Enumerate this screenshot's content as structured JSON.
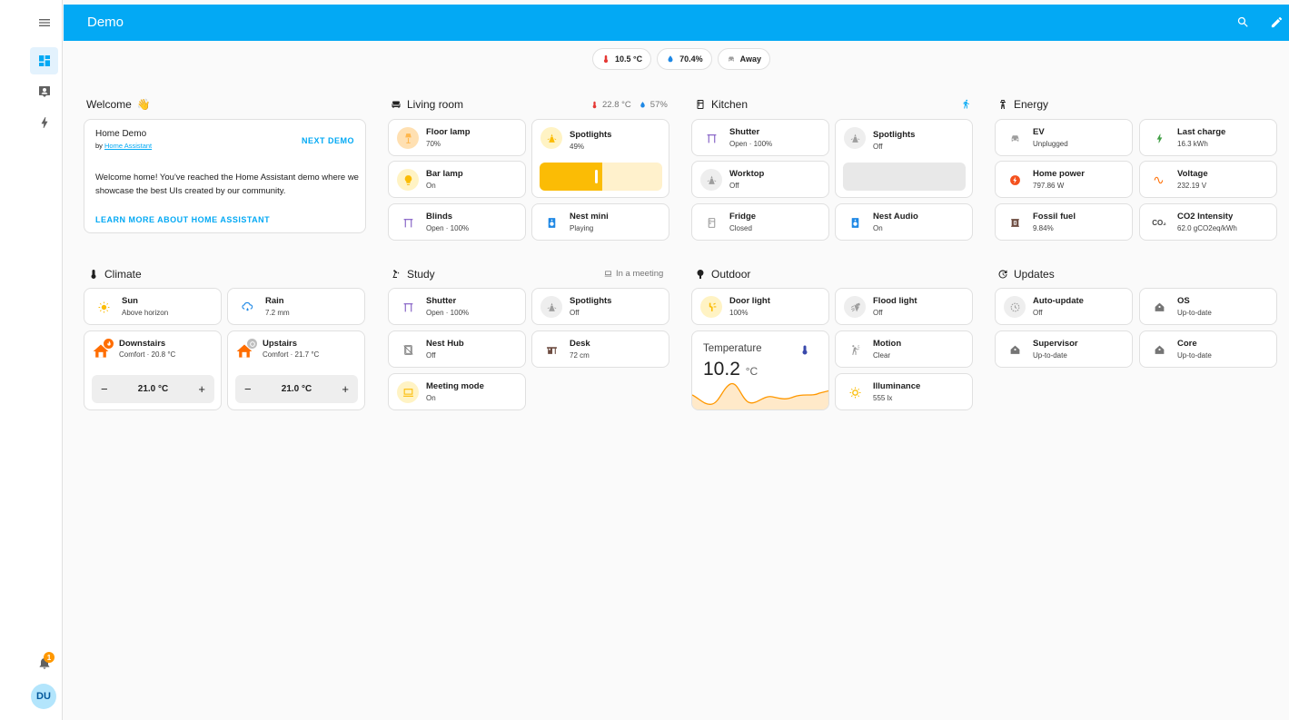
{
  "header": {
    "title": "Demo"
  },
  "colors": {
    "primary": "#03a9f4",
    "yellow": "#fbbc05",
    "orange": "#ff9800",
    "grey": "#9e9e9e",
    "purple": "#7e57c2",
    "blue": "#1e88e5",
    "brown": "#6d4c41",
    "green": "#43a047"
  },
  "sidebar": {
    "items": [
      "dashboard-icon",
      "map-icon",
      "energy-icon"
    ],
    "notification_count": "1",
    "avatar": "DU"
  },
  "badges": [
    {
      "value": "10.5 °C",
      "icon": "thermometer-icon"
    },
    {
      "value": "70.4%",
      "icon": "water-icon"
    },
    {
      "value": "Away",
      "icon": "car-icon"
    }
  ],
  "sections": {
    "welcome": {
      "title": "Welcome",
      "emoji": "👋"
    },
    "living_room": {
      "title": "Living room",
      "temp": "22.8 °C",
      "humidity": "57%"
    },
    "kitchen": {
      "title": "Kitchen"
    },
    "energy": {
      "title": "Energy"
    },
    "climate": {
      "title": "Climate"
    },
    "study": {
      "title": "Study",
      "status": "In a meeting"
    },
    "outdoor": {
      "title": "Outdoor"
    },
    "updates": {
      "title": "Updates"
    }
  },
  "welcome_card": {
    "title": "Home Demo",
    "by": "by",
    "by_link": "Home Assistant",
    "next": "NEXT DEMO",
    "body": "Welcome home! You've reached the Home Assistant demo where we showcase the best UIs created by our community.",
    "learn": "LEARN MORE ABOUT HOME ASSISTANT"
  },
  "living_room": {
    "floor_lamp": {
      "name": "Floor lamp",
      "state": "70%"
    },
    "bar_lamp": {
      "name": "Bar lamp",
      "state": "On"
    },
    "blinds": {
      "name": "Blinds",
      "state": "Open · 100%"
    },
    "spotlights": {
      "name": "Spotlights",
      "state": "49%",
      "level": 0.49
    },
    "nest_mini": {
      "name": "Nest mini",
      "state": "Playing"
    }
  },
  "kitchen": {
    "shutter": {
      "name": "Shutter",
      "state": "Open · 100%"
    },
    "worktop": {
      "name": "Worktop",
      "state": "Off"
    },
    "fridge": {
      "name": "Fridge",
      "state": "Closed"
    },
    "spotlights": {
      "name": "Spotlights",
      "state": "Off"
    },
    "nest_audio": {
      "name": "Nest Audio",
      "state": "On"
    }
  },
  "energy": {
    "ev": {
      "name": "EV",
      "state": "Unplugged"
    },
    "home_power": {
      "name": "Home power",
      "state": "797.86 W"
    },
    "fossil": {
      "name": "Fossil fuel",
      "state": "9.84%"
    },
    "last_charge": {
      "name": "Last charge",
      "state": "16.3 kWh"
    },
    "voltage": {
      "name": "Voltage",
      "state": "232.19 V"
    },
    "co2": {
      "name": "CO2 Intensity",
      "state": "62.0 gCO2eq/kWh",
      "icon_text": "CO₂"
    }
  },
  "climate": {
    "sun": {
      "name": "Sun",
      "state": "Above horizon"
    },
    "rain": {
      "name": "Rain",
      "state": "7.2 mm"
    },
    "downstairs": {
      "name": "Downstairs",
      "state": "Comfort · 20.8 °C",
      "target": "21.0 °C",
      "minus": "−",
      "plus": "+"
    },
    "upstairs": {
      "name": "Upstairs",
      "state": "Comfort · 21.7 °C",
      "target": "21.0 °C",
      "minus": "−",
      "plus": "+"
    }
  },
  "study": {
    "shutter": {
      "name": "Shutter",
      "state": "Open · 100%"
    },
    "nest_hub": {
      "name": "Nest Hub",
      "state": "Off"
    },
    "meeting": {
      "name": "Meeting mode",
      "state": "On"
    },
    "spotlights": {
      "name": "Spotlights",
      "state": "Off"
    },
    "desk": {
      "name": "Desk",
      "state": "72 cm"
    }
  },
  "outdoor": {
    "door_light": {
      "name": "Door light",
      "state": "100%"
    },
    "temperature": {
      "label": "Temperature",
      "value": "10.2",
      "unit": "°C"
    },
    "flood_light": {
      "name": "Flood light",
      "state": "Off"
    },
    "motion": {
      "name": "Motion",
      "state": "Clear"
    },
    "illuminance": {
      "name": "Illuminance",
      "state": "555 lx"
    }
  },
  "updates": {
    "auto_update": {
      "name": "Auto-update",
      "state": "Off"
    },
    "supervisor": {
      "name": "Supervisor",
      "state": "Up-to-date"
    },
    "os": {
      "name": "OS",
      "state": "Up-to-date"
    },
    "core": {
      "name": "Core",
      "state": "Up-to-date"
    }
  }
}
